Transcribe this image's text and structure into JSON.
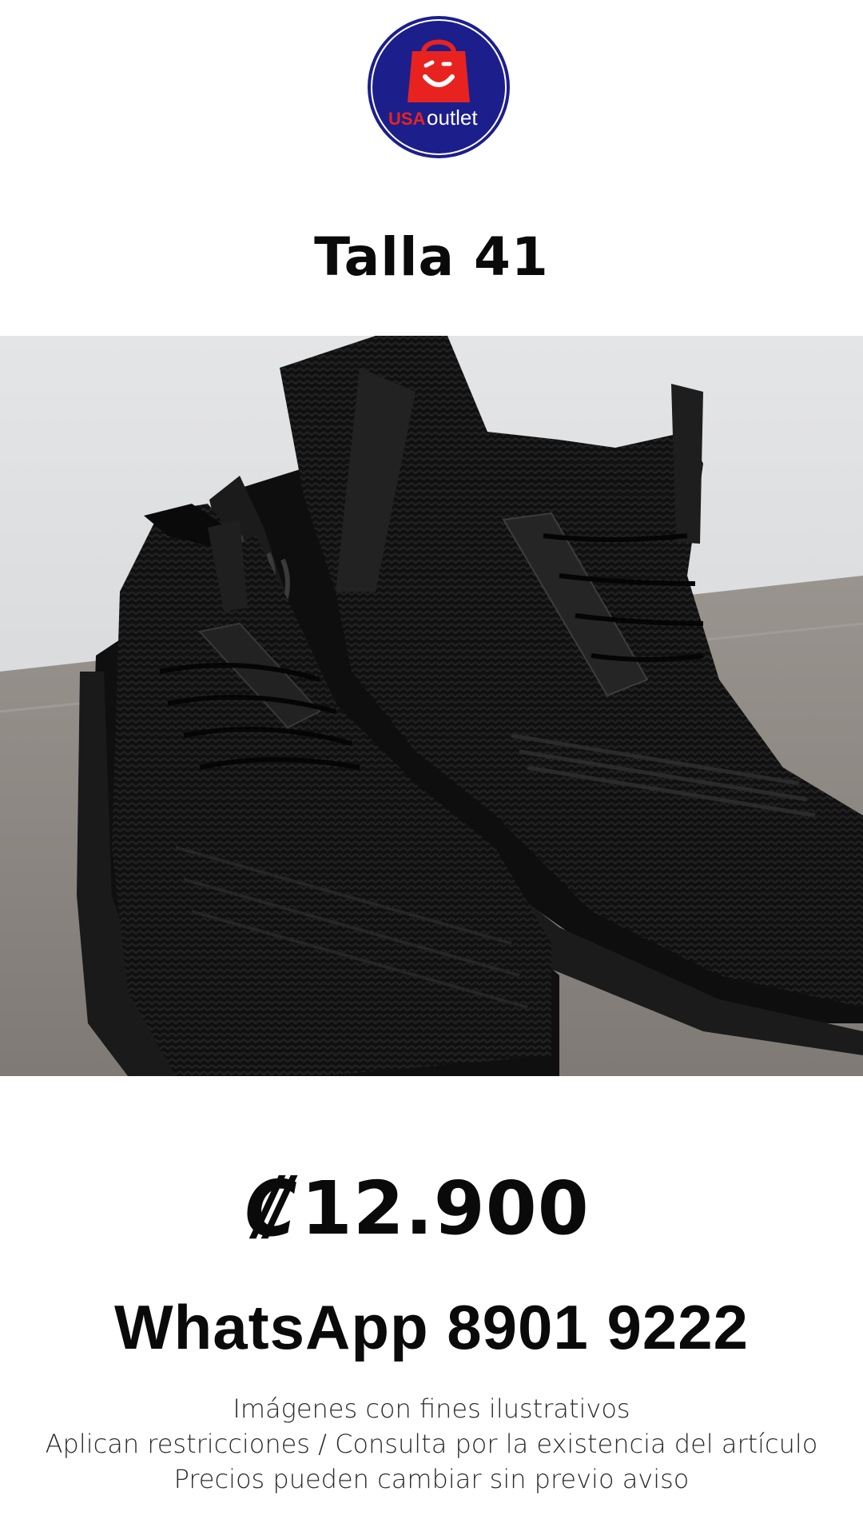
{
  "logo": {
    "brand_prefix": "USA",
    "brand_suffix": "outlet",
    "circle_color": "#1c1e8c",
    "bag_color": "#e8231f"
  },
  "title": "Talla 41",
  "product_image": {
    "icon": "black-knit-sneakers-photo"
  },
  "price": {
    "currency": "₡",
    "amount": "12.900"
  },
  "contact": "WhatsApp 8901 9222",
  "disclaimer": [
    "Imágenes con fines ilustrativos",
    "Aplican restricciones / Consulta por la existencia del artículo",
    "Precios pueden cambiar sin previo aviso"
  ]
}
